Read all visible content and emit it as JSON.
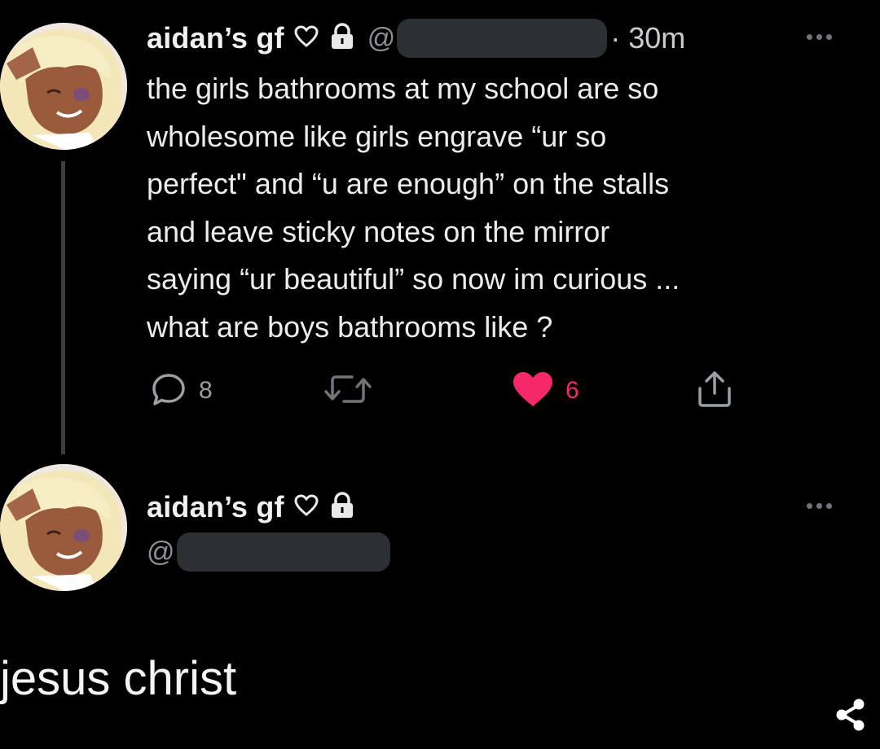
{
  "tweet": {
    "display_name": "aidan’s gf",
    "handle_prefix": "@",
    "timestamp": "· 30m",
    "body_lines": [
      "the girls bathrooms at my school are so",
      "wholesome like girls engrave “ur so",
      "perfect\" and “u are enough” on the stalls",
      "and leave sticky notes on the mirror",
      "saying “ur beautiful” so now im curious ...",
      "what are boys bathrooms like ?"
    ],
    "actions": {
      "reply_count": "8",
      "like_count": "6"
    }
  },
  "reply": {
    "display_name": "aidan’s gf",
    "handle_prefix": "@"
  },
  "caption": "jesus christ",
  "icons": [
    "heart-outline-icon",
    "lock-icon",
    "more-icon",
    "reply-icon",
    "retweet-icon",
    "like-icon",
    "share-icon",
    "share-nodes-icon"
  ],
  "colors": {
    "background": "#000000",
    "like_active": "#f4286b",
    "muted": "#9aa0a6",
    "redaction": "#2c2f33"
  }
}
